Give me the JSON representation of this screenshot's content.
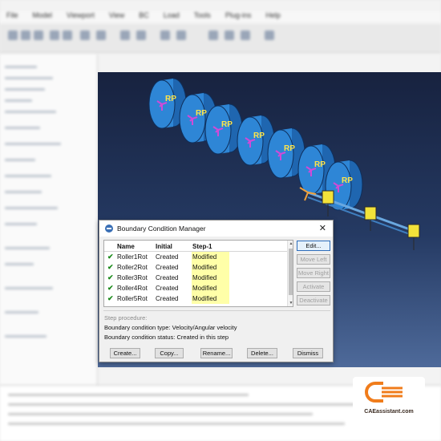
{
  "dialog": {
    "title": "Boundary Condition Manager",
    "close_label": "✕",
    "columns": [
      "Name",
      "Initial",
      "Step-1"
    ],
    "rows": [
      {
        "name": "Roller1Rot",
        "initial": "Created",
        "step": "Modified"
      },
      {
        "name": "Roller2Rot",
        "initial": "Created",
        "step": "Modified"
      },
      {
        "name": "Roller3Rot",
        "initial": "Created",
        "step": "Modified"
      },
      {
        "name": "Roller4Rot",
        "initial": "Created",
        "step": "Modified"
      },
      {
        "name": "Roller5Rot",
        "initial": "Created",
        "step": "Modified"
      }
    ],
    "check_mark": "✔",
    "side_buttons": {
      "edit": "Edit...",
      "move_left": "Move Left",
      "move_right": "Move Right",
      "activate": "Activate",
      "deactivate": "Deactivate"
    },
    "step_procedure_label": "Step procedure:",
    "bc_type": "Boundary condition type:  Velocity/Angular velocity",
    "bc_status": "Boundary condition status: Created in this step",
    "bottom_buttons": {
      "create": "Create...",
      "copy": "Copy...",
      "rename": "Rename...",
      "delete": "Delete...",
      "dismiss": "Dismiss"
    }
  },
  "viewport": {
    "rp_label": "RP",
    "roller_color": "#2e86d6",
    "marker_color": "#d04ad8",
    "label_color": "#ffe44a"
  },
  "logo": {
    "text": "CAEassistant.com",
    "accent": "#f07c1b"
  }
}
